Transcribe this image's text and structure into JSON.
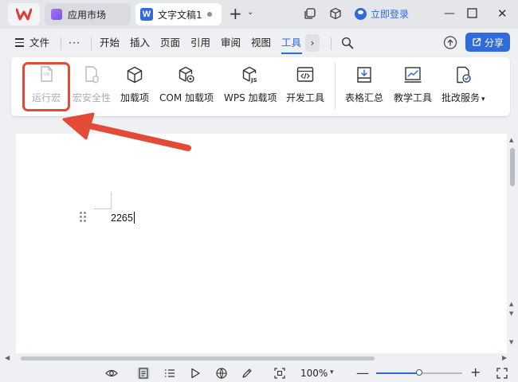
{
  "colors": {
    "accent": "#2f6bd9",
    "highlight": "#e24b38",
    "brand_red": "#e53935"
  },
  "titlebar": {
    "tabs": [
      {
        "label": "应用市场",
        "icon": "app-market-icon"
      },
      {
        "label": "文字文稿1",
        "icon": "word-doc-icon",
        "badge": "W"
      }
    ],
    "login_label": "立即登录"
  },
  "menu": {
    "file_label": "文件",
    "more_label": "···",
    "tabs": [
      "开始",
      "插入",
      "页面",
      "引用",
      "审阅",
      "视图",
      "工具"
    ],
    "active_tab": "工具",
    "share_label": "分享"
  },
  "ribbon": {
    "items": [
      {
        "label": "运行宏",
        "icon": "macro-vb-icon",
        "enabled": false
      },
      {
        "label": "宏安全性",
        "icon": "macro-security-icon",
        "enabled": false
      },
      {
        "label": "加载项",
        "icon": "addin-cube-icon",
        "enabled": true
      },
      {
        "label": "COM 加载项",
        "icon": "com-addin-icon",
        "enabled": true
      },
      {
        "label": "WPS 加载项",
        "icon": "wps-addin-icon",
        "enabled": true
      },
      {
        "label": "开发工具",
        "icon": "developer-tools-icon",
        "enabled": true
      },
      {
        "label": "表格汇总",
        "icon": "table-summary-icon",
        "enabled": true
      },
      {
        "label": "教学工具",
        "icon": "teaching-tools-icon",
        "enabled": true
      },
      {
        "label": "批改服务",
        "icon": "correction-service-icon",
        "enabled": true,
        "has_dropdown": true
      }
    ]
  },
  "document": {
    "text": "2265"
  },
  "status": {
    "zoom": "100%",
    "zoom_level": 0.5
  }
}
